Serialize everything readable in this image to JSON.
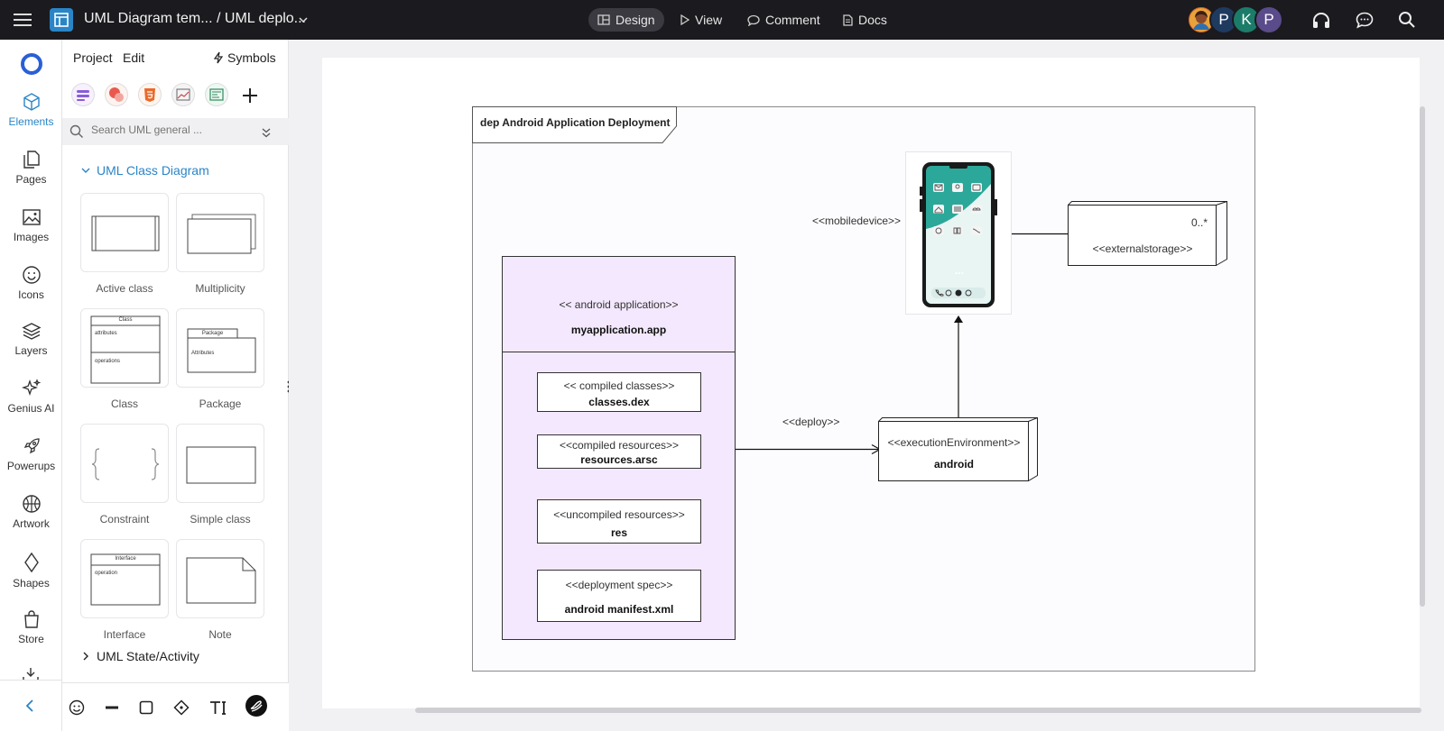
{
  "header": {
    "doc_title": "UML Diagram tem... / UML deplo...",
    "modes": [
      {
        "label": "Design",
        "active": true
      },
      {
        "label": "View",
        "active": false
      },
      {
        "label": "Comment",
        "active": false
      },
      {
        "label": "Docs",
        "active": false
      }
    ],
    "avatars": [
      {
        "initial": "",
        "color": "#d9692a"
      },
      {
        "initial": "P",
        "color": "#1e3a5f"
      },
      {
        "initial": "K",
        "color": "#1c7c6a"
      },
      {
        "initial": "P",
        "color": "#5a4b8a"
      }
    ]
  },
  "rail": {
    "items": [
      {
        "label": "Elements",
        "icon": "cube-icon",
        "active": true
      },
      {
        "label": "Pages",
        "icon": "pages-icon"
      },
      {
        "label": "Images",
        "icon": "image-icon"
      },
      {
        "label": "Icons",
        "icon": "smiley-icon"
      },
      {
        "label": "Layers",
        "icon": "layers-icon"
      },
      {
        "label": "Genius AI",
        "icon": "sparkle-icon"
      },
      {
        "label": "Powerups",
        "icon": "rocket-icon"
      },
      {
        "label": "Artwork",
        "icon": "basketball-icon"
      },
      {
        "label": "Shapes",
        "icon": "diamond-icon"
      },
      {
        "label": "Store",
        "icon": "bag-icon"
      }
    ]
  },
  "panel": {
    "tabs": {
      "project": "Project",
      "edit": "Edit",
      "symbols": "Symbols"
    },
    "search_placeholder": "Search UML general ...",
    "section_open": "UML Class Diagram",
    "section_closed": "UML State/Activity",
    "shapes": [
      {
        "label": "Active class"
      },
      {
        "label": "Multiplicity"
      },
      {
        "label": "Class",
        "thumb_title": "Class",
        "thumb_a": "attributes",
        "thumb_b": "operations"
      },
      {
        "label": "Package",
        "thumb_title": "Package",
        "thumb_a": "Attributes"
      },
      {
        "label": "Constraint"
      },
      {
        "label": "Simple class"
      },
      {
        "label": "Interface",
        "thumb_title": "Interface",
        "thumb_a": "operation"
      },
      {
        "label": "Note"
      }
    ]
  },
  "diagram": {
    "frame_title": "dep Android Application Deployment",
    "app_stereotype": "<< android application>>",
    "app_name": "myapplication.app",
    "artifacts": [
      {
        "stereotype": "<< compiled classes>>",
        "name": "classes.dex"
      },
      {
        "stereotype": "<<compiled resources>>",
        "name": "resources.arsc"
      },
      {
        "stereotype": "<<uncompiled resources>>",
        "name": "res"
      },
      {
        "stereotype": "<<deployment spec>>",
        "name": "android manifest.xml"
      }
    ],
    "deploy_label": "<<deploy>>",
    "exec_stereotype": "<<executionEnvironment>>",
    "exec_name": "android",
    "mobile_label": "<<mobiledevice>>",
    "storage_stereotype": "<<externalstorage>>",
    "storage_multiplicity": "0..*",
    "phone_dots": "..."
  },
  "colors": {
    "accent": "#2a85c7",
    "app_fill": "#f3e8fd",
    "phone_screen": "#2ba89a"
  }
}
